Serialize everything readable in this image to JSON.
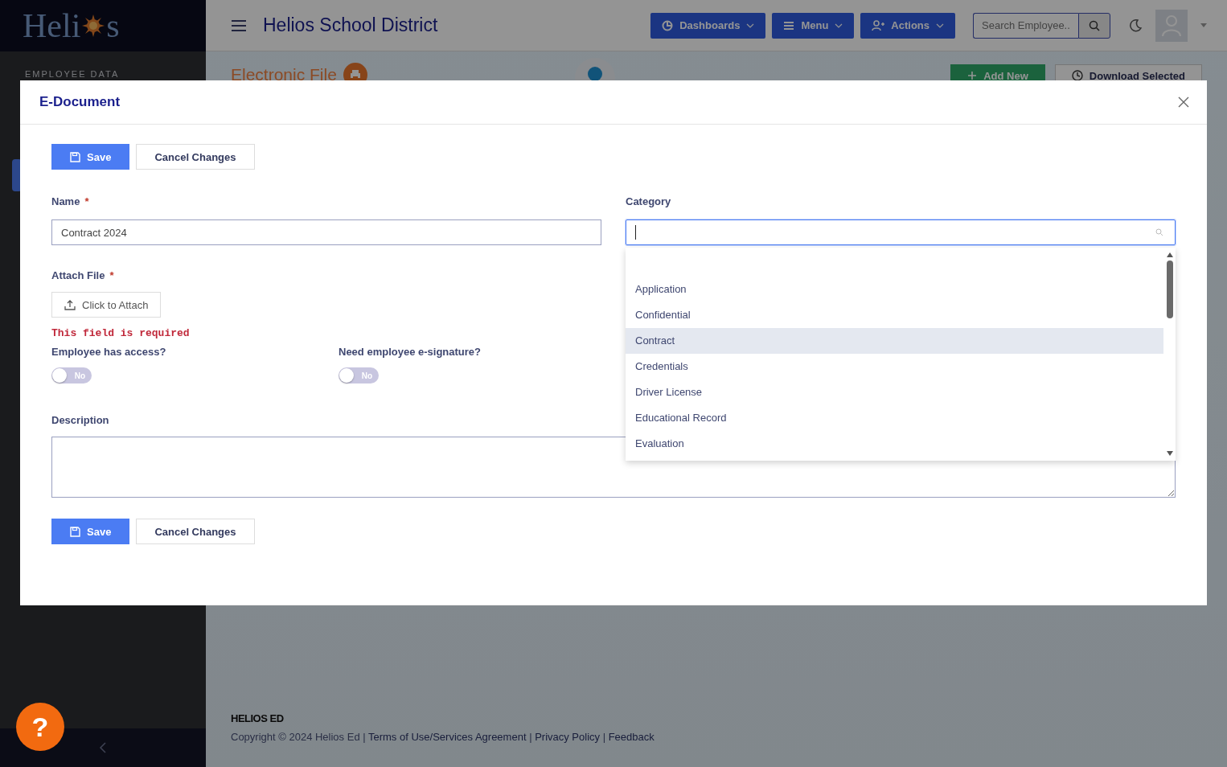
{
  "sidebar": {
    "logo_parts": [
      "Heli",
      "s"
    ],
    "section": "EMPLOYEE DATA"
  },
  "header": {
    "title": "Helios School District",
    "buttons": [
      {
        "label": "Dashboards",
        "kind": "dashboards"
      },
      {
        "label": "Menu",
        "kind": "menu"
      },
      {
        "label": "Actions",
        "kind": "actions"
      }
    ],
    "search": {
      "placeholder": "Search Employee.."
    }
  },
  "page": {
    "title": "Electronic File",
    "actions": [
      {
        "label": "Add New",
        "kind": "add"
      },
      {
        "label": "Download Selected",
        "kind": "download"
      }
    ]
  },
  "footer": {
    "brand": "HELIOS ED",
    "parts": [
      {
        "text": "Copyright © 2024 Helios Ed | ",
        "kind": "text"
      },
      {
        "text": "Terms of Use/Services Agreement",
        "kind": "link"
      },
      {
        "text": " | ",
        "kind": "text"
      },
      {
        "text": "Privacy Policy",
        "kind": "link"
      },
      {
        "text": " | ",
        "kind": "text"
      },
      {
        "text": "Feedback",
        "kind": "link"
      }
    ]
  },
  "help": "?",
  "modal": {
    "title": "E-Document",
    "buttons_top": [
      {
        "label": "Save",
        "kind": "save"
      },
      {
        "label": "Cancel Changes",
        "kind": "cancel"
      }
    ],
    "buttons_bottom": [
      {
        "label": "Save",
        "kind": "save"
      },
      {
        "label": "Cancel Changes",
        "kind": "cancel"
      }
    ],
    "name": {
      "label": "Name",
      "required_mark": "*",
      "value": "Contract 2024"
    },
    "category": {
      "label": "Category",
      "options": [
        {
          "label": "Application",
          "selected": false
        },
        {
          "label": "Confidential",
          "selected": false
        },
        {
          "label": "Contract",
          "selected": true
        },
        {
          "label": "Credentials",
          "selected": false
        },
        {
          "label": "Driver License",
          "selected": false
        },
        {
          "label": "Educational Record",
          "selected": false
        },
        {
          "label": "Evaluation",
          "selected": false
        }
      ]
    },
    "attach": {
      "label": "Attach File",
      "required_mark": "*",
      "button": "Click to Attach",
      "error": "This field is required"
    },
    "toggles": [
      {
        "label": "Employee has access?",
        "on": false,
        "text": "No"
      },
      {
        "label": "Need employee e-signature?",
        "on": false,
        "text": "No"
      }
    ],
    "description": {
      "label": "Description"
    }
  }
}
